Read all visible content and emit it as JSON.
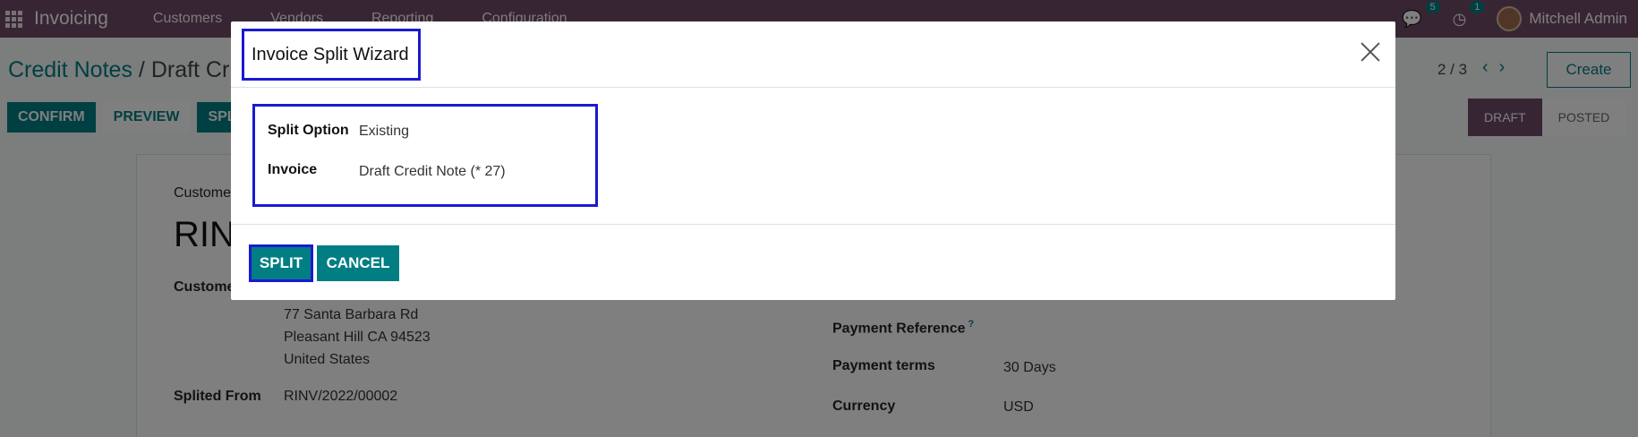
{
  "navbar": {
    "app_name": "Invoicing",
    "menu": [
      "Customers",
      "Vendors",
      "Reporting",
      "Configuration"
    ],
    "messages_count": "5",
    "activities_count": "1",
    "user_name": "Mitchell Admin"
  },
  "breadcrumb": {
    "parent": "Credit Notes",
    "separator": "/",
    "current": "Draft Cr"
  },
  "pager": {
    "partial_label": "n",
    "value": "2 / 3"
  },
  "create_label": "Create",
  "actions": {
    "confirm": "CONFIRM",
    "preview": "PREVIEW",
    "split": "SPL"
  },
  "statusbar": {
    "draft": "DRAFT",
    "posted": "POSTED"
  },
  "sheet": {
    "customer_label_top": "Custome",
    "record_name": "RIN",
    "customer_label": "Custome",
    "address": [
      "77 Santa Barbara Rd",
      "Pleasant Hill CA 94523",
      "United States"
    ],
    "splited_from_label": "Splited From",
    "splited_from_value": "RINV/2022/00002",
    "payment_reference_label": "Payment Reference",
    "payment_reference_hint": "?",
    "payment_terms_label": "Payment terms",
    "payment_terms_value": "30 Days",
    "currency_label": "Currency",
    "currency_value": "USD"
  },
  "modal": {
    "title": "Invoice Split Wizard",
    "split_option_label": "Split Option",
    "split_option_value": "Existing",
    "invoice_label": "Invoice",
    "invoice_value": "Draft Credit Note (* 27)",
    "split_button": "SPLIT",
    "cancel_button": "CANCEL"
  },
  "colors": {
    "navbar": "#714b67",
    "primary": "#017e84",
    "highlight": "#1a1ad1"
  }
}
